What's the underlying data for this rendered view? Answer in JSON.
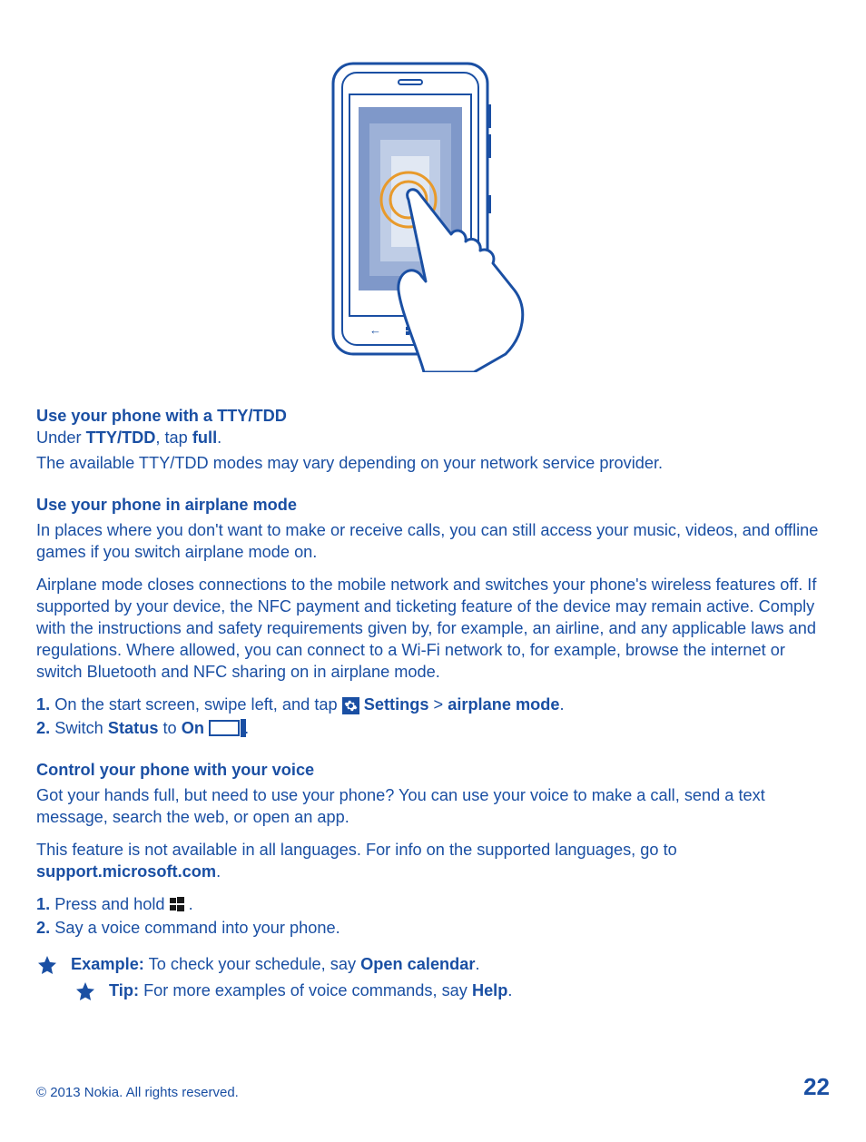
{
  "section_tty": {
    "heading": "Use your phone with a TTY/TDD",
    "line1_prefix": "Under ",
    "line1_bold1": "TTY/TDD",
    "line1_mid": ", tap ",
    "line1_bold2": "full",
    "line1_suffix": ".",
    "para": "The available TTY/TDD modes may vary depending on your network service provider."
  },
  "section_airplane": {
    "heading": "Use your phone in airplane mode",
    "para1": "In places where you don't want to make or receive calls, you can still access your music, videos, and offline games if you switch airplane mode on.",
    "para2": "Airplane mode closes connections to the mobile network and switches your phone's wireless features off. If supported by your device, the NFC payment and ticketing feature of the device may remain active. Comply with the instructions and safety requirements given by, for example, an airline, and any applicable laws and regulations. Where allowed, you can connect to a Wi-Fi network to, for example, browse the internet or switch Bluetooth and NFC sharing on in airplane mode.",
    "step1_num": "1.",
    "step1_text": " On the start screen, swipe left, and tap ",
    "step1_settings": "Settings",
    "step1_gt": " > ",
    "step1_mode": "airplane mode",
    "step1_end": ".",
    "step2_num": "2.",
    "step2_text": " Switch ",
    "step2_status": "Status",
    "step2_to": " to ",
    "step2_on": "On",
    "step2_end": " ."
  },
  "section_voice": {
    "heading": "Control your phone with your voice",
    "para1": "Got your hands full, but need to use your phone? You can use your voice to make a call, send a text message, search the web, or open an app.",
    "para2_a": "This feature is not available in all languages. For info on the supported languages, go to ",
    "para2_b": "support.microsoft.com",
    "para2_c": ".",
    "step1_num": "1.",
    "step1_text": " Press and hold ",
    "step1_end": " .",
    "step2_num": "2.",
    "step2_text": " Say a voice command into your phone.",
    "example_label": "Example:",
    "example_text": " To check your schedule, say ",
    "example_bold": "Open calendar",
    "example_end": ".",
    "tip_label": "Tip:",
    "tip_text": " For more examples of voice commands, say ",
    "tip_bold": "Help",
    "tip_end": "."
  },
  "footer": {
    "copyright": "© 2013 Nokia. All rights reserved.",
    "page": "22"
  }
}
